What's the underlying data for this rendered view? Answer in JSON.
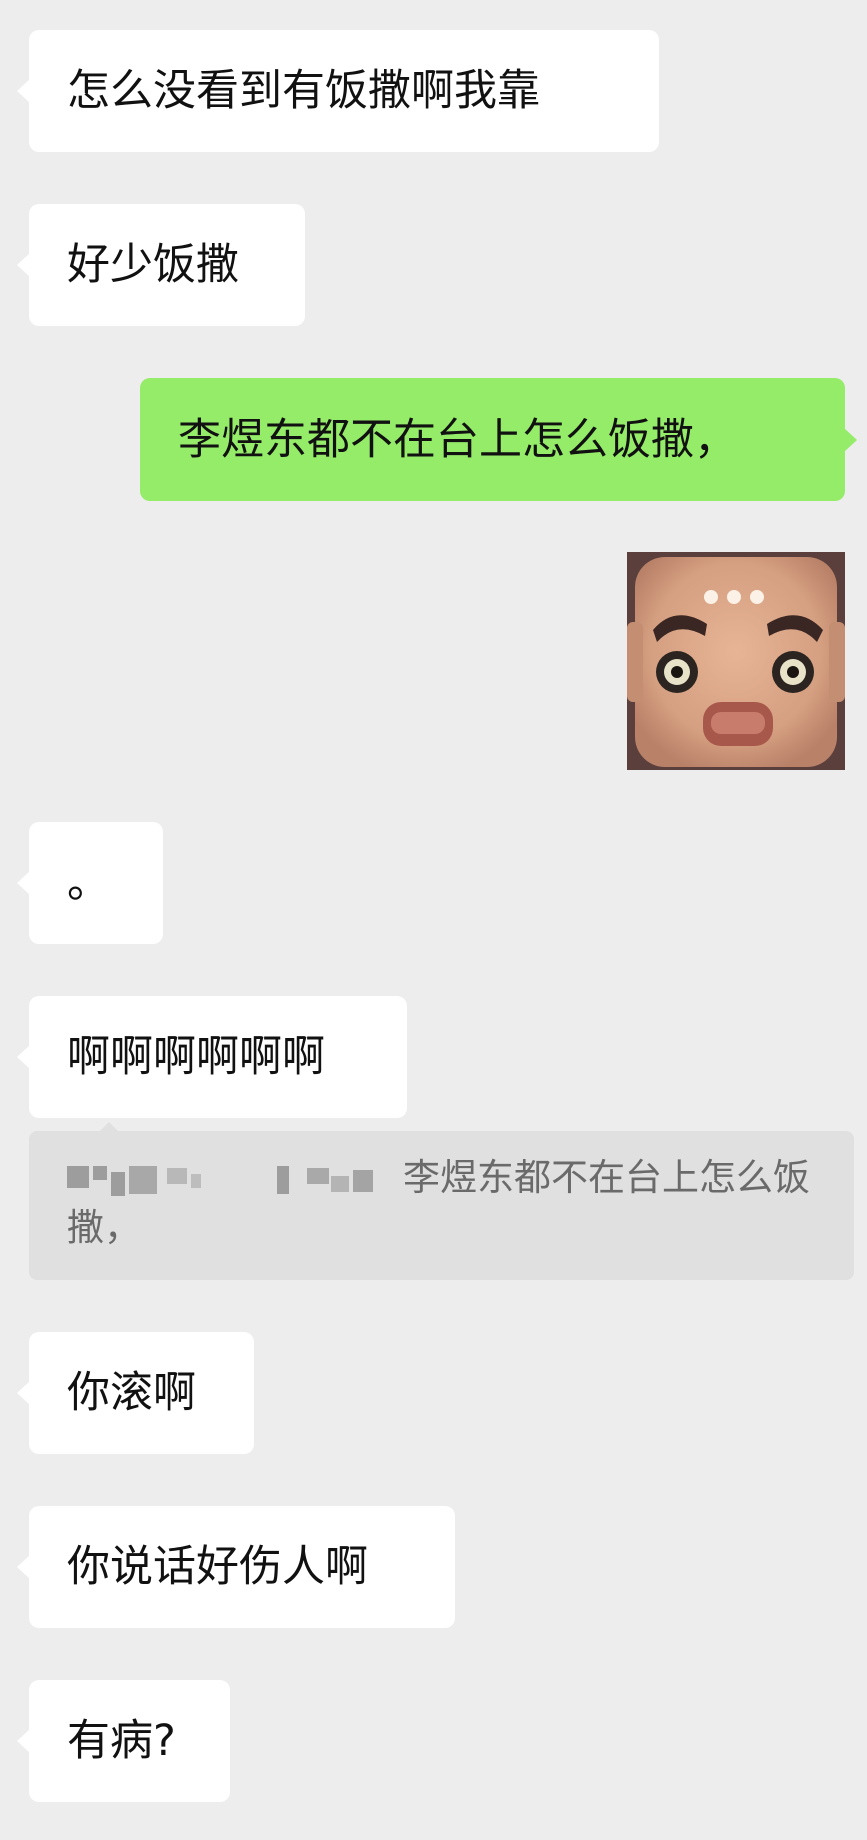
{
  "chat": {
    "messages": [
      {
        "side": "in",
        "text": "怎么没看到有饭撒啊我靠"
      },
      {
        "side": "in",
        "text": "好少饭撒"
      },
      {
        "side": "out",
        "text": "李煜东都不在台上怎么饭撒，"
      },
      {
        "side": "out",
        "type": "sticker",
        "icon": "cartoon-face-sticker"
      },
      {
        "side": "in",
        "text": "。"
      },
      {
        "side": "in",
        "text": "啊啊啊啊啊啊"
      },
      {
        "side": "in",
        "type": "quote",
        "text": "李煜东都不在台上怎么饭撒，",
        "sender_redacted": true
      },
      {
        "side": "in",
        "text": "你滚啊"
      },
      {
        "side": "in",
        "text": "你说话好伤人啊"
      },
      {
        "side": "in",
        "text": "有病?"
      }
    ]
  },
  "colors": {
    "background": "#ededed",
    "incoming_bubble": "#ffffff",
    "outgoing_bubble": "#95ec69",
    "quote_background": "#e0e0e0"
  }
}
